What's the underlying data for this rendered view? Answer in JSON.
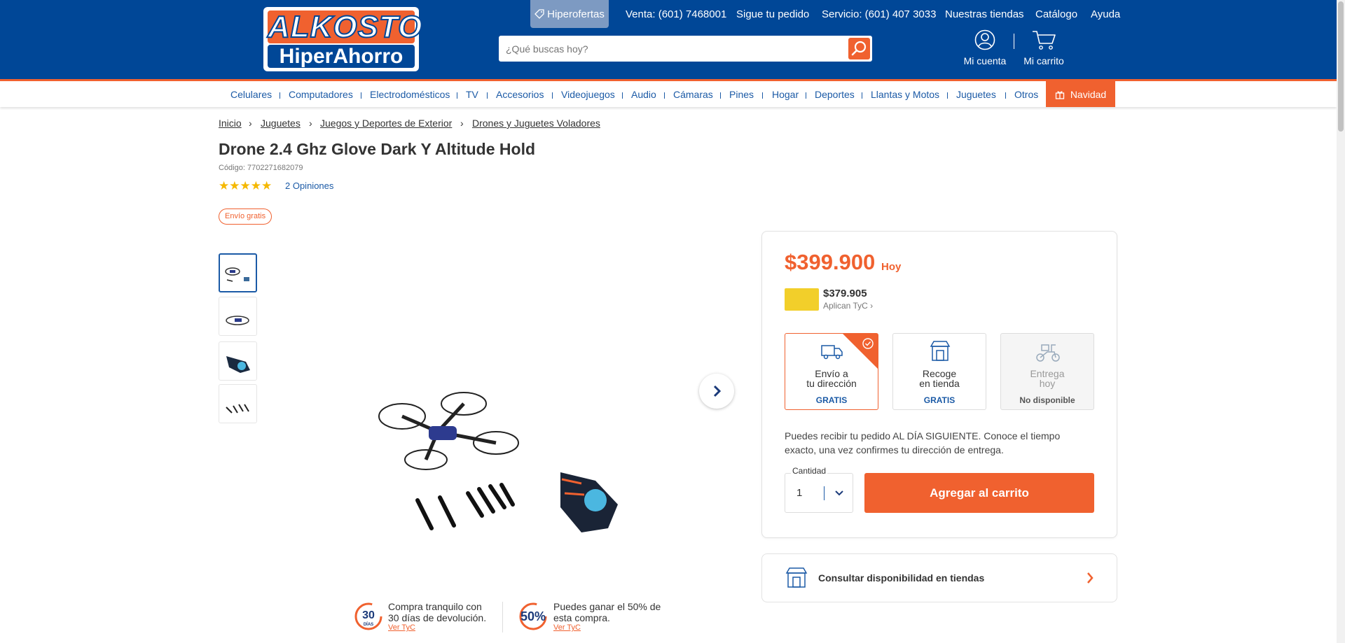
{
  "header": {
    "logo_top": "ALKOSTO",
    "logo_bottom": "HiperAhorro",
    "hiperofertas": "Hiperofertas",
    "venta": "Venta: (601) 7468001",
    "pedido": "Sigue tu pedido",
    "servicio": "Servicio: (601) 407 3033",
    "tiendas": "Nuestras tiendas",
    "catalogo": "Catálogo",
    "ayuda": "Ayuda",
    "search_placeholder": "¿Qué buscas hoy?",
    "mi_cuenta": "Mi cuenta",
    "mi_carrito": "Mi carrito"
  },
  "nav": [
    "Celulares",
    "Computadores",
    "Electrodomésticos",
    "TV",
    "Accesorios",
    "Videojuegos",
    "Audio",
    "Cámaras",
    "Pines",
    "Hogar",
    "Deportes",
    "Llantas y Motos",
    "Juguetes",
    "Otros"
  ],
  "navidad": "Navidad",
  "breadcrumb": [
    "Inicio",
    "Juguetes",
    "Juegos y Deportes de Exterior",
    "Drones y Juguetes Voladores"
  ],
  "product": {
    "title": "Drone 2.4 Ghz Glove Dark Y Altitude Hold",
    "code": "Código: 7702271682079",
    "rating": 5,
    "opinions": "2 Opiniones",
    "shipping_badge": "Envío gratis"
  },
  "pricing": {
    "price": "$399.900",
    "price_suffix": "Hoy",
    "card_price": "$379.905",
    "card_tyc": "Aplican TyC"
  },
  "delivery_options": [
    {
      "line1": "Envío a",
      "line2": "tu dirección",
      "sub": "GRATIS"
    },
    {
      "line1": "Recoge",
      "line2": "en tienda",
      "sub": "GRATIS"
    },
    {
      "line1": "Entrega",
      "line2": "hoy",
      "sub": "No disponible"
    }
  ],
  "delivery_desc": "Puedes recibir tu pedido AL DÍA SIGUIENTE. Conoce el tiempo exacto, una vez confirmes tu dirección de entrega.",
  "quantity": {
    "label": "Cantidad",
    "value": "1"
  },
  "add_to_cart": "Agregar al carrito",
  "store_check": "Consultar disponibilidad en tiendas",
  "guarantees": [
    {
      "badge": "30",
      "badge_sub": "DÍAS",
      "line1": "Compra tranquilo con",
      "line2": "30 días de devolución.",
      "link": "Ver TyC"
    },
    {
      "badge": "50%",
      "line1": "Puedes ganar el 50% de",
      "line2": "esta compra.",
      "link": "Ver TyC"
    }
  ],
  "colors": {
    "brand_blue": "#004797",
    "accent_orange": "#f0612f",
    "link_blue": "#1b5aa6"
  }
}
